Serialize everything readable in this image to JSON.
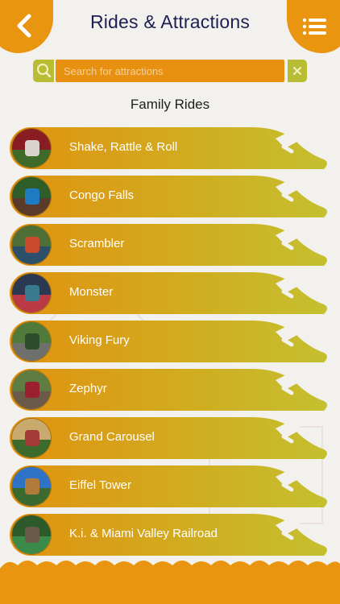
{
  "header": {
    "title": "Rides & Attractions",
    "back_icon": "chevron-left-icon",
    "menu_icon": "hamburger-menu-icon"
  },
  "search": {
    "placeholder": "Search for attractions",
    "search_icon": "search-icon",
    "clear_icon": "close-icon"
  },
  "section": {
    "title": "Family Rides"
  },
  "rides": [
    {
      "name": "Shake, Rattle & Roll",
      "thumb_colors": [
        "#8a1c24",
        "#3f6b2a",
        "#d9d2cf"
      ]
    },
    {
      "name": "Congo Falls",
      "thumb_colors": [
        "#2f5d2a",
        "#5a3b2a",
        "#1e7cc2"
      ]
    },
    {
      "name": "Scrambler",
      "thumb_colors": [
        "#4d6f35",
        "#2c4f6a",
        "#c84a2f"
      ]
    },
    {
      "name": "Monster",
      "thumb_colors": [
        "#2a3852",
        "#b93a44",
        "#3a7a8e"
      ]
    },
    {
      "name": "Viking Fury",
      "thumb_colors": [
        "#4f7a3a",
        "#6f6f6b",
        "#2d4e2a"
      ]
    },
    {
      "name": "Zephyr",
      "thumb_colors": [
        "#5f7d43",
        "#6b5a4a",
        "#9a2030"
      ]
    },
    {
      "name": "Grand Carousel",
      "thumb_colors": [
        "#c8a96e",
        "#3d6b2e",
        "#a33a3a"
      ]
    },
    {
      "name": "Eiffel Tower",
      "thumb_colors": [
        "#2f73c7",
        "#3a6a30",
        "#b07a3a"
      ]
    },
    {
      "name": "K.i. & Miami Valley Railroad",
      "thumb_colors": [
        "#2c5a2a",
        "#3a8a4a",
        "#6a5a4a"
      ]
    }
  ],
  "colors": {
    "accent_orange": "#e8900f",
    "accent_olive": "#b8bd33",
    "banner_start": "#e1920f",
    "banner_end": "#c4c02e",
    "title_navy": "#1f2052"
  }
}
